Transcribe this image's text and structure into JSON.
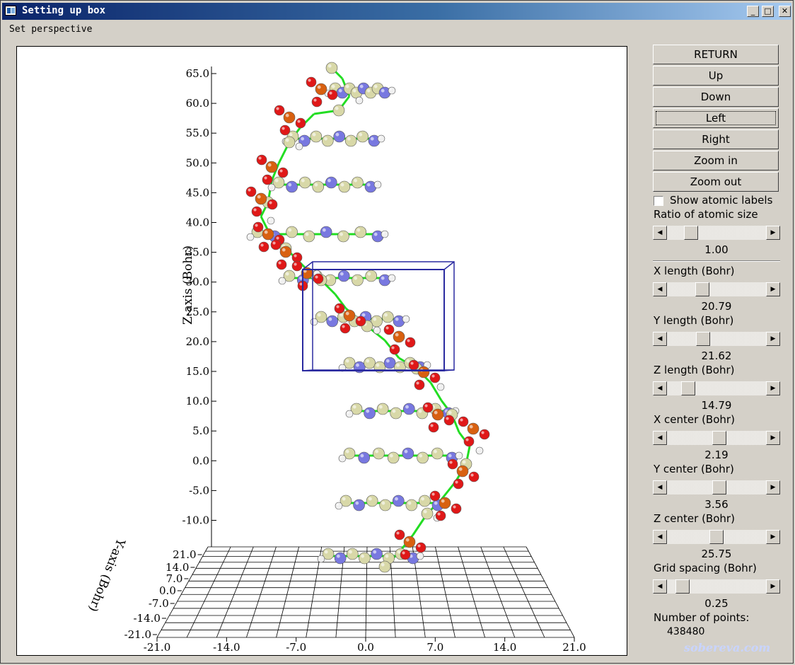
{
  "window": {
    "title": "Setting up box",
    "controls": [
      "_",
      "□",
      "✕"
    ],
    "menu_text": "Set perspective"
  },
  "buttons": [
    "RETURN",
    "Up",
    "Down",
    "Left",
    "Right",
    "Zoom in",
    "Zoom out"
  ],
  "checkbox": {
    "label": "Show atomic labels",
    "checked": false
  },
  "ratio": {
    "label": "Ratio of atomic size",
    "value": "1.00",
    "level": 0.2
  },
  "params": [
    {
      "label": "X length (Bohr)",
      "value": "20.79",
      "level": 0.33
    },
    {
      "label": "Y length (Bohr)",
      "value": "21.62",
      "level": 0.34
    },
    {
      "label": "Z length (Bohr)",
      "value": "14.79",
      "level": 0.17
    },
    {
      "label": "X center (Bohr)",
      "value": "2.19",
      "level": 0.53
    },
    {
      "label": "Y center (Bohr)",
      "value": "3.56",
      "level": 0.53
    },
    {
      "label": "Z center (Bohr)",
      "value": "25.75",
      "level": 0.5
    },
    {
      "label": "Grid spacing (Bohr)",
      "value": "0.25",
      "level": 0.1
    }
  ],
  "points": {
    "label": "Number of points:",
    "value": "438480"
  },
  "watermark": "sobereva.com",
  "plot": {
    "z_axis_label": "Z-axis (Bohr)",
    "y_axis_label": "Y-axis (Bohr)",
    "z_ticks": [
      "65.0",
      "60.0",
      "55.0",
      "50.0",
      "45.0",
      "40.0",
      "35.0",
      "30.0",
      "25.0",
      "20.0",
      "15.0",
      "10.0",
      "5.0",
      "0.0",
      "-5.0",
      "-10.0"
    ],
    "y_ticks": [
      "21.0",
      "14.0",
      "7.0",
      "0.0",
      "-7.0",
      "-14.0",
      "-21.0"
    ],
    "x_ticks": [
      "-21.0",
      "-14.0",
      "-7.0",
      "0.0",
      "7.0",
      "14.0",
      "21.0"
    ],
    "colors": {
      "carbon": "#d8d8a8",
      "oxygen": "#e01818",
      "hydrogen": "#f0f0f0",
      "nitrogen": "#7878e0",
      "phosphorus": "#d86010",
      "bond": "#22dd22",
      "box": "#2a2aa0"
    }
  }
}
